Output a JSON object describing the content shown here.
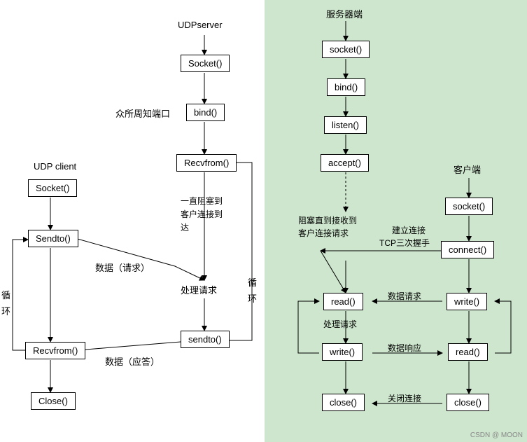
{
  "udp": {
    "client_title": "UDP client",
    "server_title": "UDPserver",
    "client": {
      "socket": "Socket()",
      "sendto": "Sendto()",
      "recvfrom": "Recvfrom()",
      "close": "Close()"
    },
    "server": {
      "socket": "Socket()",
      "bind": "bind()",
      "recvfrom": "Recvfrom()",
      "sendto": "sendto()"
    },
    "labels": {
      "well_known_port": "众所周知端口",
      "block_until": "一直阻塞到\n客户连接到\n达",
      "process_req": "处理请求",
      "data_req": "数据（请求）",
      "data_resp": "数据（应答）",
      "loop_left": "循\n环",
      "loop_right": "循\n环"
    }
  },
  "tcp": {
    "server_title": "服务器端",
    "client_title": "客户端",
    "server": {
      "socket": "socket()",
      "bind": "bind()",
      "listen": "listen()",
      "accept": "accept()",
      "read": "read()",
      "write": "write()",
      "close": "close()"
    },
    "client": {
      "socket": "socket()",
      "connect": "connect()",
      "write": "write()",
      "read": "read()",
      "close": "close()"
    },
    "labels": {
      "block_until_req": "阻塞直到接收到\n客户连接请求",
      "establish": "建立连接",
      "handshake": "TCP三次握手",
      "data_req": "数据请求",
      "process": "处理请求",
      "data_resp": "数据响应",
      "close_conn": "关闭连接"
    }
  },
  "watermark": "CSDN @ MOON"
}
